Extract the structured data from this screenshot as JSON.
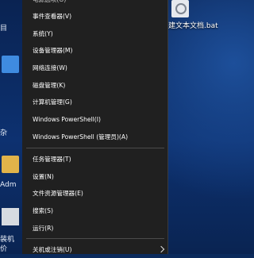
{
  "menu": {
    "items": [
      {
        "label": "电源选项(O)",
        "name": "menu-item-power-options"
      },
      {
        "label": "事件查看器(V)",
        "name": "menu-item-event-viewer"
      },
      {
        "label": "系统(Y)",
        "name": "menu-item-system"
      },
      {
        "label": "设备管理器(M)",
        "name": "menu-item-device-manager"
      },
      {
        "label": "网络连接(W)",
        "name": "menu-item-network-connections"
      },
      {
        "label": "磁盘管理(K)",
        "name": "menu-item-disk-management"
      },
      {
        "label": "计算机管理(G)",
        "name": "menu-item-computer-management"
      },
      {
        "label": "Windows PowerShell(I)",
        "name": "menu-item-powershell"
      },
      {
        "label": "Windows PowerShell (管理员)(A)",
        "name": "menu-item-powershell-admin"
      },
      {
        "label": "任务管理器(T)",
        "name": "menu-item-task-manager"
      },
      {
        "label": "设置(N)",
        "name": "menu-item-settings"
      },
      {
        "label": "文件资源管理器(E)",
        "name": "menu-item-file-explorer"
      },
      {
        "label": "搜索(S)",
        "name": "menu-item-search"
      },
      {
        "label": "运行(R)",
        "name": "menu-item-run"
      },
      {
        "label": "关机或注销(U)",
        "name": "menu-item-shutdown-signout"
      }
    ]
  },
  "desktop": {
    "file_label": "建文本文档.bat",
    "left_labels": [
      "目",
      "杂",
      "Adm",
      "装机",
      "价"
    ]
  }
}
